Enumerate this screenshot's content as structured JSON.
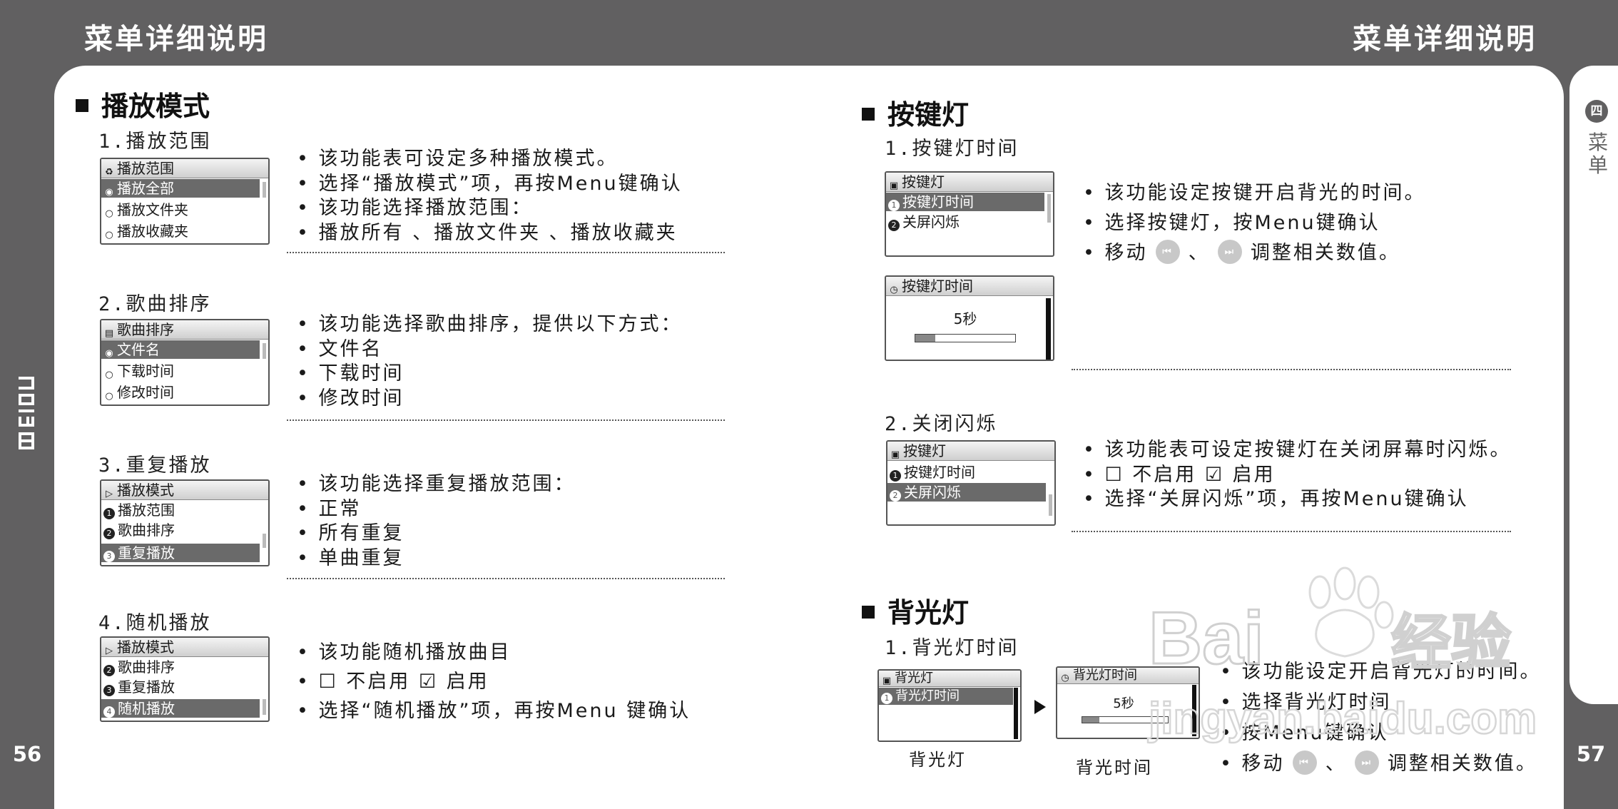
{
  "header": {
    "left_title": "菜单详细说明",
    "right_title": "菜单详细说明"
  },
  "page_numbers": {
    "left": "56",
    "right": "57"
  },
  "brand": "MEIZU",
  "side_tab": {
    "circle": "四",
    "label": "菜单"
  },
  "left": {
    "section_title": "播放模式",
    "items": [
      {
        "sub": "1.播放范围",
        "screen": {
          "title": "播放范围",
          "rows": [
            "播放全部",
            "播放文件夹",
            "播放收藏夹"
          ]
        },
        "desc": [
          "• 该功能表可设定多种播放模式。",
          "• 选择“播放模式”项，再按Menu键确认",
          "• 该功能选择播放范围：",
          "• 播放所有 、播放文件夹 、播放收藏夹"
        ]
      },
      {
        "sub": "2.歌曲排序",
        "screen": {
          "title": "歌曲排序",
          "rows": [
            "文件名",
            "下载时间",
            "修改时间"
          ]
        },
        "desc": [
          "• 该功能选择歌曲排序，提供以下方式：",
          "• 文件名",
          "• 下载时间",
          "• 修改时间"
        ]
      },
      {
        "sub": "3.重复播放",
        "screen": {
          "title": "播放模式",
          "rows": [
            "播放范围",
            "歌曲排序",
            "重复播放"
          ]
        },
        "desc": [
          "• 该功能选择重复播放范围：",
          "• 正常",
          "• 所有重复",
          "• 单曲重复"
        ]
      },
      {
        "sub": "4.随机播放",
        "screen": {
          "title": "播放模式",
          "rows": [
            "歌曲排序",
            "重复播放",
            "随机播放"
          ]
        },
        "desc": [
          "• 该功能随机播放曲目",
          "• ☐ 不启用    ☑ 启用",
          "• 选择“随机播放”项，再按Menu 键确认"
        ]
      }
    ]
  },
  "right": {
    "keylight": {
      "section_title": "按键灯",
      "item1": {
        "sub": "1.按键灯时间",
        "screen": {
          "title": "按键灯",
          "rows": [
            "按键灯时间",
            "关屏闪烁"
          ]
        },
        "screen2": {
          "title": "按键灯时间",
          "value": "5秒",
          "level": 0.2
        },
        "desc1": "• 该功能设定按键开启背光的时间。",
        "desc2": "• 选择按键灯，按Menu键确认",
        "desc3_pre": "• 移动",
        "desc3_mid": "、",
        "desc3_post": "调整相关数值。"
      },
      "item2": {
        "sub": "2.关闭闪烁",
        "screen": {
          "title": "按键灯",
          "rows": [
            "按键灯时间",
            "关屏闪烁"
          ]
        },
        "desc": [
          "• 该功能表可设定按键灯在关闭屏幕时闪烁。",
          "• ☐ 不启用    ☑ 启用",
          "• 选择“关屏闪烁”项，再按Menu键确认"
        ]
      }
    },
    "backlight": {
      "section_title": "背光灯",
      "sub": "1.背光灯时间",
      "screen": {
        "title": "背光灯",
        "rows": [
          "背光灯时间"
        ],
        "caption": "背光灯"
      },
      "screen2": {
        "title": "背光灯时间",
        "value": "5秒",
        "level": 0.2,
        "caption": "背光时间"
      },
      "desc1": "• 该功能设定开启背光灯的时间。",
      "desc2": "• 选择背光灯时间",
      "desc3": "• 按Menu键确认",
      "desc4_pre": "• 移动",
      "desc4_mid": "、",
      "desc4_post": "调整相关数值。"
    }
  },
  "watermark": {
    "brand": "Bai",
    "cn": "经验",
    "url": "jingyan.baidu.com"
  }
}
